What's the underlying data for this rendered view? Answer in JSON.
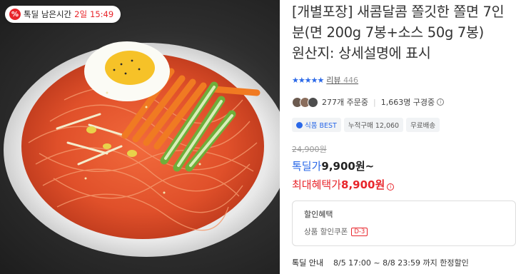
{
  "deal_timer": {
    "prefix_icon": "percent-icon",
    "label": "톡딜 남은시간",
    "days": "2일",
    "time": "15:49"
  },
  "product": {
    "title": "[개별포장] 새콤달콤 쫄깃한 쫄면 7인분(면 200g 7봉+소스 50g 7봉)\n원산지: 상세설명에 표시",
    "rating_stars": "★★★★★",
    "review_label": "리뷰",
    "review_count": "446",
    "ordering": "277개 주문중",
    "watching": "1,663명 구경중",
    "badges": [
      "식품 BEST",
      "누적구매 12,060",
      "무료배송"
    ],
    "original_price": "24,900원",
    "deal_label": "톡딜가",
    "deal_price": "9,900원~",
    "max_benefit_label": "최대혜택가",
    "max_benefit_price": "8,900원",
    "benefit_box": {
      "title": "할인혜택",
      "coupon": "상품 할인쿠폰",
      "dday": "D-3"
    },
    "notice": {
      "label": "톡딜 안내",
      "text": "8/5 17:00 ~ 8/8 23:59 까지 한정할인"
    }
  },
  "colors": {
    "accent_blue": "#2a68e8",
    "accent_red": "#e8252b"
  }
}
